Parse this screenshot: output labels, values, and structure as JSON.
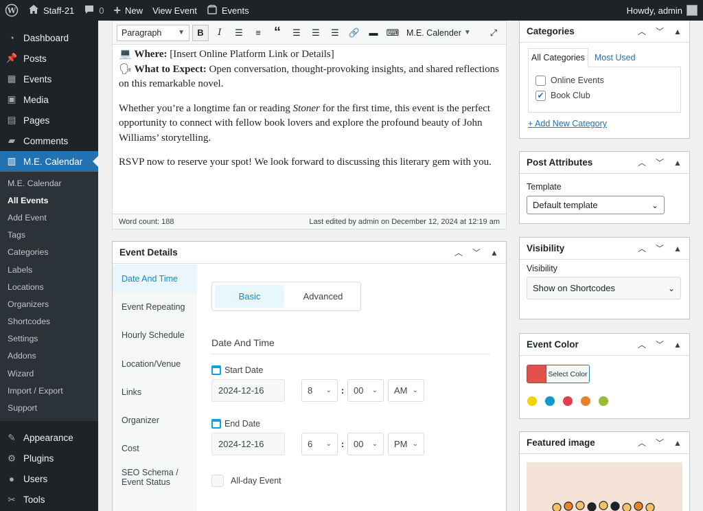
{
  "admin_bar": {
    "site_name": "Staff-21",
    "comments_count": "0",
    "new_label": "New",
    "view_event_label": "View Event",
    "events_label": "Events",
    "howdy": "Howdy, admin"
  },
  "sidebar": {
    "items_top": [
      {
        "label": "Dashboard",
        "icon": "dashboard-icon"
      },
      {
        "label": "Posts",
        "icon": "pin-icon"
      },
      {
        "label": "Events",
        "icon": "calendar-icon"
      },
      {
        "label": "Media",
        "icon": "media-icon"
      },
      {
        "label": "Pages",
        "icon": "pages-icon"
      },
      {
        "label": "Comments",
        "icon": "comment-icon"
      },
      {
        "label": "M.E. Calendar",
        "icon": "me-calendar-icon"
      }
    ],
    "submenu": [
      "M.E. Calendar",
      "All Events",
      "Add Event",
      "Tags",
      "Categories",
      "Labels",
      "Locations",
      "Organizers",
      "Shortcodes",
      "Settings",
      "Addons",
      "Wizard",
      "Import / Export",
      "Support"
    ],
    "items_bottom": [
      {
        "label": "Appearance",
        "icon": "brush-icon"
      },
      {
        "label": "Plugins",
        "icon": "plugin-icon"
      },
      {
        "label": "Users",
        "icon": "user-icon"
      },
      {
        "label": "Tools",
        "icon": "wrench-icon"
      }
    ]
  },
  "editor": {
    "format_select": "Paragraph",
    "me_calendar_button": "M.E. Calender",
    "where_label": "Where:",
    "where_text": " [Insert Online Platform Link or Details]",
    "expect_label": "What to Expect:",
    "expect_text": " Open conversation, thought-provoking insights, and shared reflections on this remarkable novel.",
    "para2_a": "Whether you’re a longtime fan or reading ",
    "para2_italic": "Stoner",
    "para2_b": " for the first time, this event is the perfect opportunity to connect with fellow book lovers and explore the profound beauty of John Williams’ storytelling.",
    "para3": "RSVP now to reserve your spot! We look forward to discussing this literary gem with you.",
    "word_count": "Word count: 188",
    "last_edited": "Last edited by admin on December 12, 2024 at 12:19 am"
  },
  "event_details": {
    "title": "Event Details",
    "tabs": [
      "Date And Time",
      "Event Repeating",
      "Hourly Schedule",
      "Location/Venue",
      "Links",
      "Organizer",
      "Cost",
      "SEO Schema / Event Status"
    ],
    "seg_basic": "Basic",
    "seg_advanced": "Advanced",
    "section_title": "Date And Time",
    "start_label": "Start Date",
    "start_date": "2024-12-16",
    "start_hour": "8",
    "start_min": "00",
    "start_ampm": "AM",
    "end_label": "End Date",
    "end_date": "2024-12-16",
    "end_hour": "6",
    "end_min": "00",
    "end_ampm": "PM",
    "allday_label": "All-day Event"
  },
  "categories": {
    "title": "Categories",
    "tab_all": "All Categories",
    "tab_used": "Most Used",
    "items": [
      {
        "label": "Online Events",
        "checked": false
      },
      {
        "label": "Book Club",
        "checked": true
      }
    ],
    "add_new": "+ Add New Category"
  },
  "post_attributes": {
    "title": "Post Attributes",
    "template_label": "Template",
    "template_value": "Default template"
  },
  "visibility": {
    "title": "Visibility",
    "label": "Visibility",
    "value": "Show on Shortcodes"
  },
  "event_color": {
    "title": "Event Color",
    "button": "Select Color",
    "current": "#e2514a",
    "presets": [
      "#f5d20a",
      "#0e97d0",
      "#e0404a",
      "#e9822c",
      "#9bb93a"
    ]
  },
  "featured_image": {
    "title": "Featured image"
  }
}
